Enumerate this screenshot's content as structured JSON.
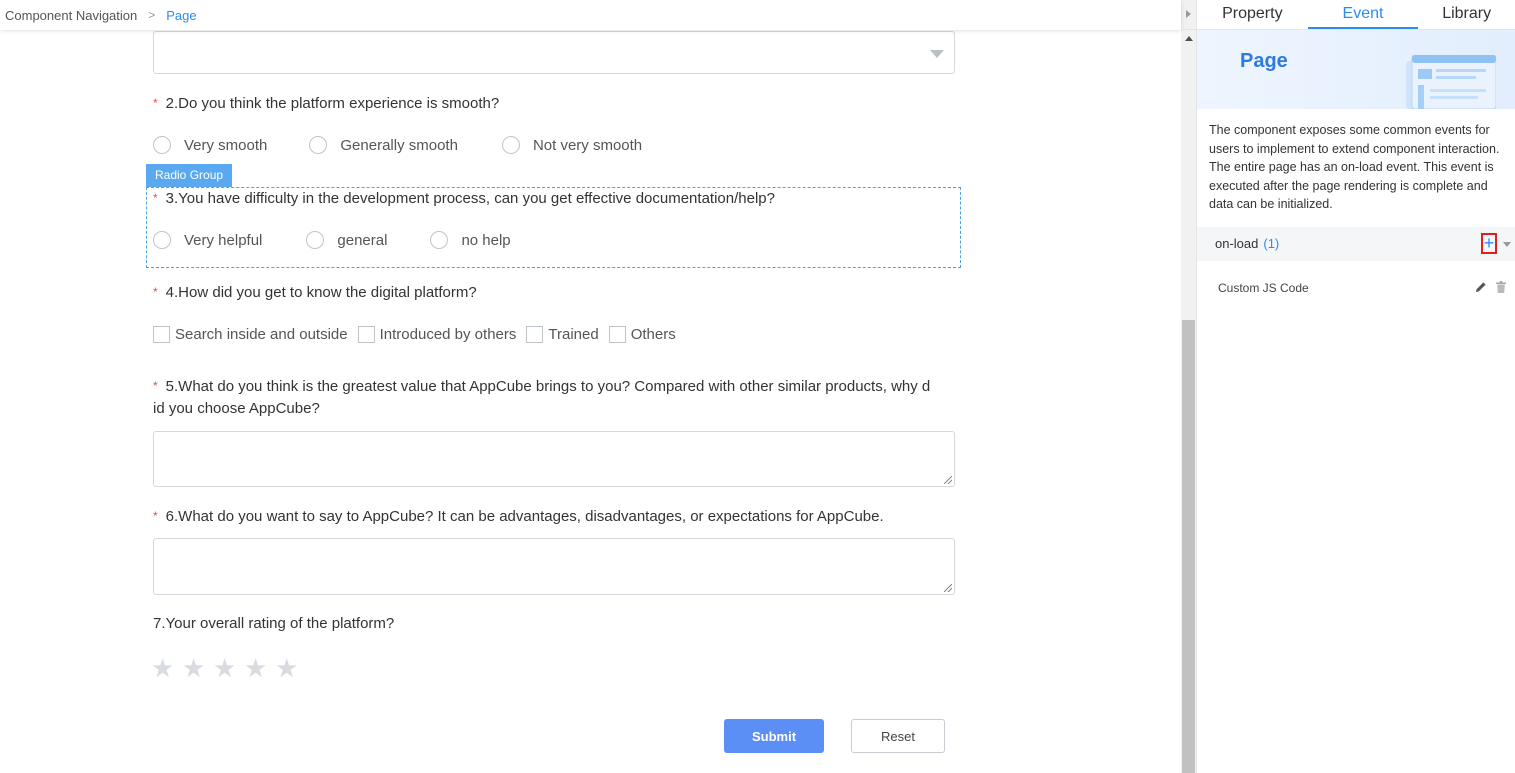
{
  "breadcrumb": {
    "root": "Component Navigation",
    "separator": ">",
    "current": "Page"
  },
  "form": {
    "q2": {
      "required": "*",
      "text": "2.Do you think the platform experience is smooth?",
      "options": [
        "Very smooth",
        "Generally smooth",
        "Not very smooth"
      ]
    },
    "component_tag": "Radio Group",
    "q3": {
      "required": "*",
      "text": "3.You have difficulty in the development process, can you get effective documentation/help?",
      "options": [
        "Very helpful",
        "general",
        "no help"
      ]
    },
    "q4": {
      "required": "*",
      "text": "4.How did you get to know the digital platform?",
      "options": [
        "Search inside and outside",
        "Introduced by others",
        "Trained",
        "Others"
      ]
    },
    "q5": {
      "required": "*",
      "text_line1": "5.What do you think is the greatest value that AppCube brings to you? Compared with other similar products, why d",
      "text_line2": "id you choose AppCube?",
      "value": ""
    },
    "q6": {
      "required": "*",
      "text": "6.What do you want to say to AppCube? It can be advantages, disadvantages, or expectations for AppCube.",
      "value": ""
    },
    "q7": {
      "text": "7.Your overall rating of the platform?",
      "rating": 0,
      "max": 5
    },
    "submit_label": "Submit",
    "reset_label": "Reset"
  },
  "panel": {
    "tabs": [
      "Property",
      "Event",
      "Library"
    ],
    "active_tab": "Event",
    "title": "Page",
    "description": "The component exposes some common events for users to implement to extend component interaction. The entire page has an on-load event. This event is executed after the page rendering is complete and data can be initialized.",
    "event": {
      "name": "on-load",
      "count": "(1)",
      "add_symbol": "+"
    },
    "action": {
      "label": "Custom JS Code"
    }
  },
  "colors": {
    "accent": "#2d8cf0",
    "submit": "#5b8ff5",
    "required": "#f04a4a",
    "highlight": "#e02020"
  }
}
